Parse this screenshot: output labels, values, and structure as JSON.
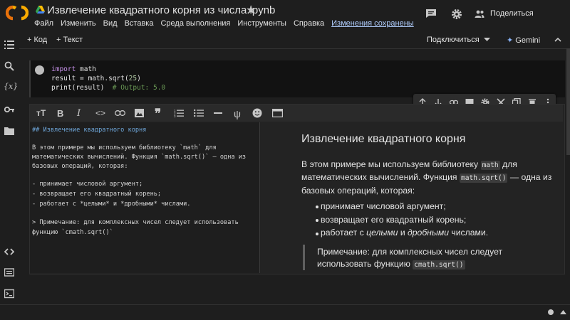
{
  "header": {
    "title": "Извлечение квадратного корня из числа.ipynb",
    "share_label": "Поделиться",
    "menu": [
      "Файл",
      "Изменить",
      "Вид",
      "Вставка",
      "Среда выполнения",
      "Инструменты",
      "Справка"
    ],
    "saved_status": "Изменения сохранены"
  },
  "toolbar": {
    "add_code": "+ Код",
    "add_text": "+ Текст",
    "connect": "Подключиться",
    "gemini": "Gemini"
  },
  "code_cell": {
    "lines": [
      "import math",
      "result = math.sqrt(25)",
      "print(result)  # Output: 5.0"
    ]
  },
  "text_cell": {
    "markdown": [
      "## Извлечение квадратного корня",
      "",
      "В этом примере мы используем библиотеку `math` для",
      "математических вычислений. Функция `math.sqrt()` — одна из",
      "базовых операций, которая:",
      "",
      "- принимает числовой аргумент;",
      "- возвращает его квадратный корень;",
      "- работает с *целыми* и *дробными* числами.",
      "",
      "> Примечание: для комплексных чисел следует использовать",
      "функцию `cmath.sqrt()`"
    ],
    "preview": {
      "heading": "Извлечение квадратного корня",
      "p1_a": "В этом примере мы используем библиотеку",
      "p1_code": "math",
      "p1_b": "для",
      "p2_a": "математических вычислений. Функция",
      "p2_code": "math.sqrt()",
      "p2_b": "— одна из",
      "p3": "базовых операций, которая:",
      "bullet1": "принимает числовой аргумент;",
      "bullet2": "возвращает его квадратный корень;",
      "bullet3_a": "работает с",
      "bullet3_i1": "целыми",
      "bullet3_b": "и",
      "bullet3_i2": "дробными",
      "bullet3_c": "числами.",
      "quote1": "Примечание: для комплексных чисел следует",
      "quote2_a": "использовать функцию",
      "quote2_code": "cmath.sqrt()"
    }
  },
  "colors": {
    "accent": "#f9ab00",
    "link": "#aecbfa",
    "background": "#1e1e1e"
  }
}
